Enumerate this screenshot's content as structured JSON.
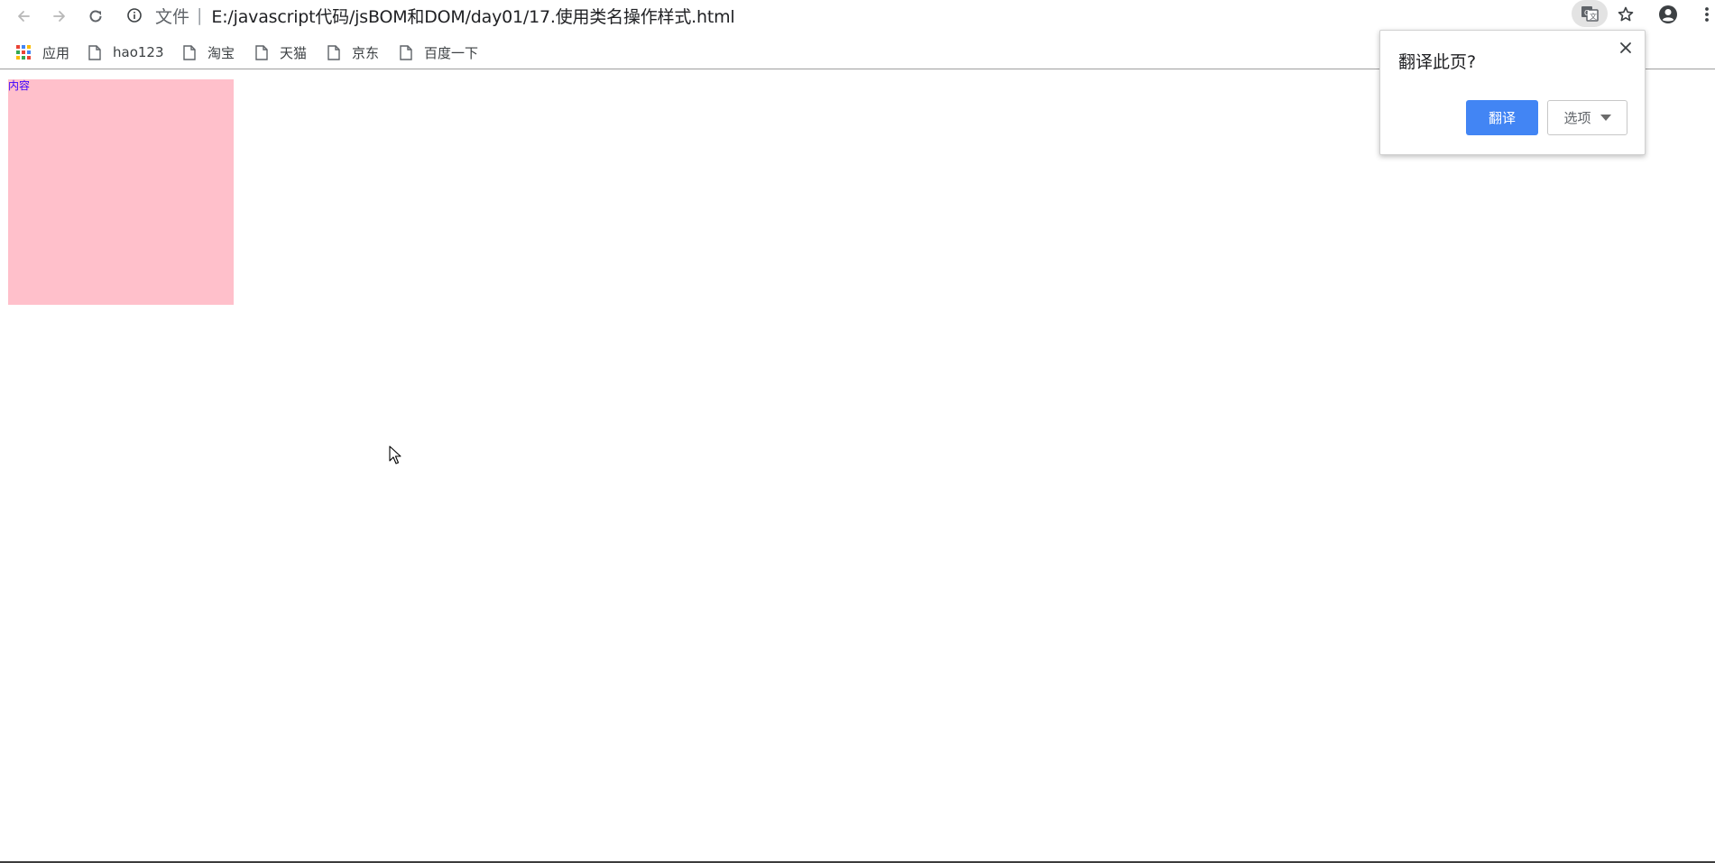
{
  "browser": {
    "address_bar": {
      "site_label": "文件",
      "separator": "|",
      "url": "E:/javascript代码/jsBOM和DOM/day01/17.使用类名操作样式.html"
    },
    "bookmarks": [
      {
        "label": "应用",
        "icon": "apps-grid-icon"
      },
      {
        "label": "hao123",
        "icon": "page-icon"
      },
      {
        "label": "淘宝",
        "icon": "page-icon"
      },
      {
        "label": "天猫",
        "icon": "page-icon"
      },
      {
        "label": "京东",
        "icon": "page-icon"
      },
      {
        "label": "百度一下",
        "icon": "page-icon"
      }
    ]
  },
  "page": {
    "box_text": "内容",
    "box_color": "#ffc0cb",
    "text_color": "#3b00ff"
  },
  "translate_popup": {
    "title": "翻译此页?",
    "translate_button": "翻译",
    "options_button": "选项"
  },
  "colors": {
    "accent": "#4285f4"
  }
}
